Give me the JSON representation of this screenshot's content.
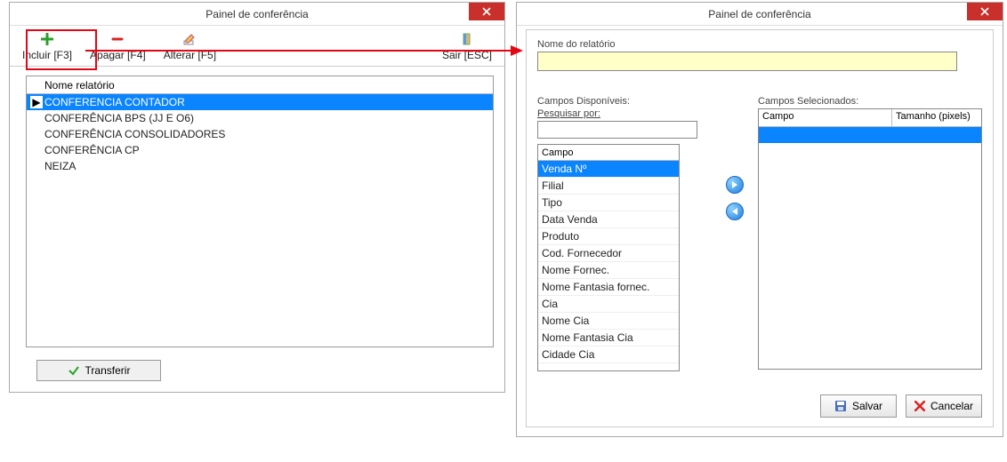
{
  "left_window": {
    "title": "Painel de conferência",
    "toolbar": {
      "incluir": "Incluir [F3]",
      "apagar": "Apagar [F4]",
      "alterar": "Alterar [F5]",
      "sair": "Sair [ESC]"
    },
    "list_header": "Nome relatório",
    "rows": [
      "CONFERENCIA CONTADOR",
      "CONFERÊNCIA BPS (JJ E O6)",
      "CONFERÊNCIA CONSOLIDADORES",
      "CONFERÊNCIA CP",
      "NEIZA"
    ],
    "selected_index": 0,
    "transfer": "Transferir"
  },
  "right_window": {
    "title": "Painel de conferência",
    "report_name_label": "Nome do relatório",
    "report_name_value": "",
    "available_label": "Campos Disponíveis:",
    "search_label": "Pesquisar por:",
    "search_value": "",
    "available_header": "Campo",
    "available": [
      "Venda Nº",
      "Filial",
      "Tipo",
      "Data Venda",
      "Produto",
      "Cod. Fornecedor",
      "Nome Fornec.",
      "Nome Fantasia fornec.",
      "Cia",
      "Nome Cia",
      "Nome Fantasia Cia",
      "Cidade Cia"
    ],
    "available_selected_index": 0,
    "selected_label": "Campos Selecionados:",
    "selected_headers": {
      "campo": "Campo",
      "tamanho": "Tamanho (pixels)"
    },
    "save": "Salvar",
    "cancel": "Cancelar"
  },
  "icons": {
    "plus": "plus-icon",
    "minus": "minus-icon",
    "edit": "edit-icon",
    "door": "door-icon",
    "close": "close-icon",
    "check": "check-icon",
    "arrow_right": "arrow-right-icon",
    "arrow_left": "arrow-left-icon",
    "save": "save-icon",
    "cancel": "cancel-icon"
  }
}
